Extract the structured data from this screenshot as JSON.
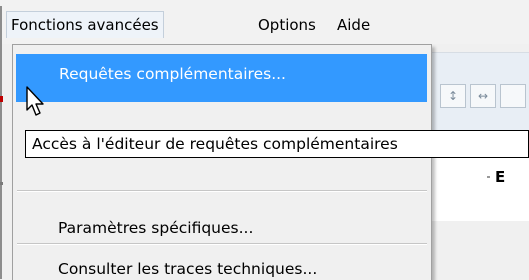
{
  "menubar": {
    "items": [
      {
        "label": "Fonctions avancées",
        "open": true
      },
      {
        "label": "Options",
        "open": false
      },
      {
        "label": "Aide",
        "open": false
      }
    ]
  },
  "dropdown": {
    "items": [
      {
        "label": "Requêtes complémentaires...",
        "highlighted": true
      },
      {
        "label": "Paramètres spécifiques...",
        "highlighted": false
      },
      {
        "label": "Consulter les traces techniques...",
        "highlighted": false
      }
    ],
    "highlight_color": "#3399ff"
  },
  "tooltip": {
    "text": "Accès à l'éditeur de requêtes complémentaires"
  },
  "background": {
    "grid_header": "E"
  },
  "icons": [
    "mouse-pointer-icon",
    "resize-vertical-icon",
    "resize-horizontal-icon"
  ]
}
